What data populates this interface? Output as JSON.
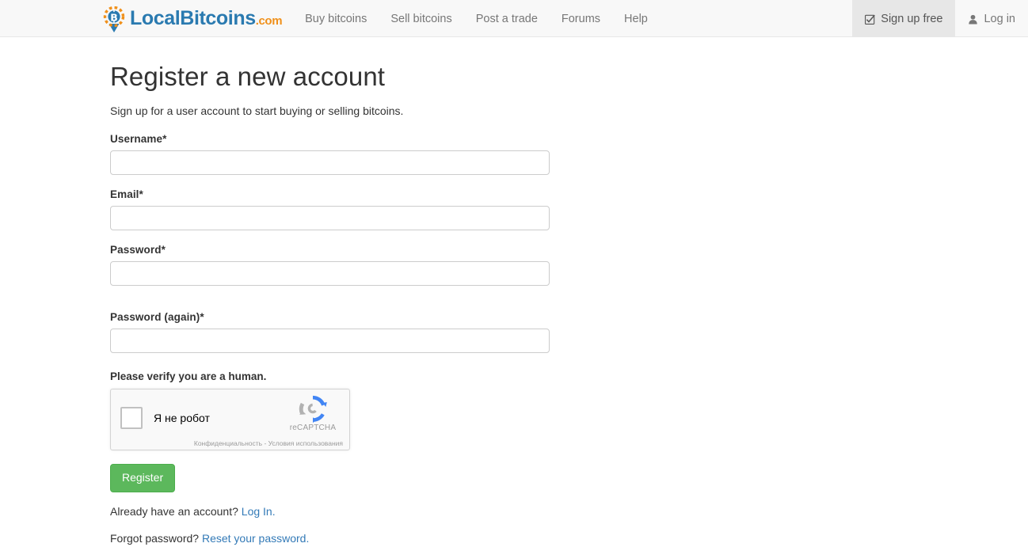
{
  "navbar": {
    "brand": {
      "name": "LocalBitcoins",
      "tld": ".com",
      "logo_icon": "bitcoin-map-pin-icon"
    },
    "links": [
      {
        "label": "Buy bitcoins",
        "name": "nav-buy-bitcoins"
      },
      {
        "label": "Sell bitcoins",
        "name": "nav-sell-bitcoins"
      },
      {
        "label": "Post a trade",
        "name": "nav-post-a-trade"
      },
      {
        "label": "Forums",
        "name": "nav-forums"
      },
      {
        "label": "Help",
        "name": "nav-help"
      }
    ],
    "right": {
      "signup_label": "Sign up free",
      "signup_icon": "check-square-icon",
      "login_label": "Log in",
      "login_icon": "user-icon"
    }
  },
  "page": {
    "title": "Register a new account",
    "lead": "Sign up for a user account to start buying or selling bitcoins."
  },
  "form": {
    "fields": [
      {
        "label": "Username*",
        "value": "",
        "placeholder": "",
        "name": "username-input"
      },
      {
        "label": "Email*",
        "value": "",
        "placeholder": "",
        "name": "email-input"
      },
      {
        "label": "Password*",
        "value": "",
        "placeholder": "",
        "name": "password-input"
      },
      {
        "label": "Password (again)*",
        "value": "",
        "placeholder": "",
        "name": "password-confirm-input"
      }
    ],
    "captcha": {
      "label": "Please verify you are a human.",
      "checkbox_text": "Я не робот",
      "brand": "reCAPTCHA",
      "fine_print": "Конфиденциальность - Условия использования",
      "logo_icon": "recaptcha-refresh-icon"
    },
    "submit_label": "Register"
  },
  "footer": {
    "already_text": "Already have an account? ",
    "already_link": "Log In.",
    "forgot_text": "Forgot password? ",
    "forgot_link": "Reset your password."
  },
  "colors": {
    "brand_blue": "#2a7ab0",
    "brand_orange": "#f0901a",
    "link": "#337ab7",
    "success": "#5cb85c",
    "navbar_bg": "#f8f8f8",
    "navbar_active_bg": "#e7e7e7"
  }
}
